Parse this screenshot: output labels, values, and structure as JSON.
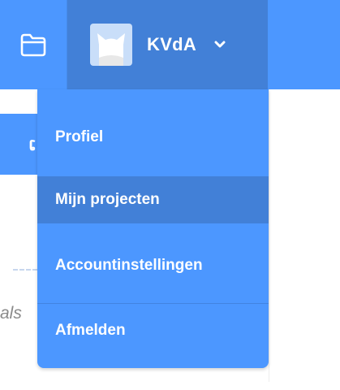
{
  "header": {
    "folder_icon": "folder-icon",
    "account": {
      "avatar_icon": "cat-avatar",
      "username": "KVdA",
      "chevron_icon": "chevron-down-icon"
    }
  },
  "background": {
    "left_button_glyph": "ເ",
    "side_text": "als"
  },
  "account_menu": {
    "items": [
      {
        "label": "Profiel"
      },
      {
        "label": "Mijn projecten",
        "highlighted": true
      },
      {
        "label": "Accountinstellingen"
      },
      {
        "label": "Afmelden"
      }
    ]
  },
  "colors": {
    "topbar": "#4c97ff",
    "topbar_active": "#4280d7",
    "menu_bg": "#4c97ff",
    "menu_hover": "#4280d7"
  }
}
